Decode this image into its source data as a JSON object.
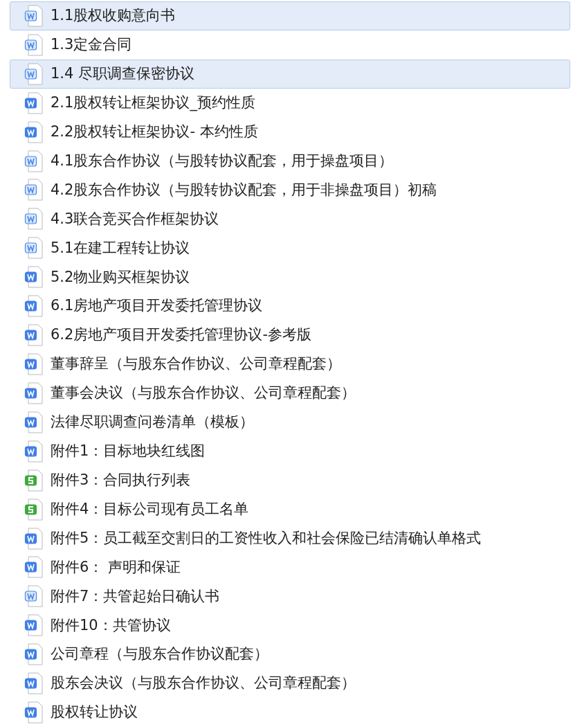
{
  "files": [
    {
      "name": "1.1股权收购意向书",
      "kind": "doc-outline",
      "selected": true
    },
    {
      "name": "1.3定金合同",
      "kind": "doc-outline",
      "selected": false
    },
    {
      "name": "1.4 尽职调查保密协议",
      "kind": "doc-outline",
      "selected": true
    },
    {
      "name": "2.1股权转让框架协议_预约性质",
      "kind": "doc",
      "selected": false
    },
    {
      "name": "2.2股权转让框架协议- 本约性质",
      "kind": "doc",
      "selected": false
    },
    {
      "name": "4.1股东合作协议（与股转协议配套，用于操盘项目）",
      "kind": "doc-outline",
      "selected": false
    },
    {
      "name": "4.2股东合作协议（与股转协议配套，用于非操盘项目）初稿",
      "kind": "doc-outline",
      "selected": false
    },
    {
      "name": "4.3联合竞买合作框架协议",
      "kind": "doc-outline",
      "selected": false
    },
    {
      "name": "5.1在建工程转让协议",
      "kind": "doc-outline",
      "selected": false
    },
    {
      "name": "5.2物业购买框架协议",
      "kind": "doc",
      "selected": false
    },
    {
      "name": "6.1房地产项目开发委托管理协议",
      "kind": "doc",
      "selected": false
    },
    {
      "name": "6.2房地产项目开发委托管理协议-参考版",
      "kind": "doc",
      "selected": false
    },
    {
      "name": "董事辞呈（与股东合作协议、公司章程配套）",
      "kind": "doc",
      "selected": false
    },
    {
      "name": "董事会决议（与股东合作协议、公司章程配套）",
      "kind": "doc",
      "selected": false
    },
    {
      "name": "法律尽职调查问卷清单（模板）",
      "kind": "doc",
      "selected": false
    },
    {
      "name": "附件1：目标地块红线图",
      "kind": "doc",
      "selected": false
    },
    {
      "name": "附件3：合同执行列表",
      "kind": "sheet",
      "selected": false
    },
    {
      "name": "附件4：目标公司现有员工名单",
      "kind": "sheet",
      "selected": false
    },
    {
      "name": "附件5：员工截至交割日的工资性收入和社会保险已结清确认单格式",
      "kind": "doc",
      "selected": false
    },
    {
      "name": "附件6： 声明和保证",
      "kind": "doc",
      "selected": false
    },
    {
      "name": "附件7：共管起始日确认书",
      "kind": "doc-outline",
      "selected": false
    },
    {
      "name": "附件10：共管协议",
      "kind": "doc",
      "selected": false
    },
    {
      "name": "公司章程（与股东合作协议配套）",
      "kind": "doc",
      "selected": false
    },
    {
      "name": "股东会决议（与股东合作协议、公司章程配套）",
      "kind": "doc",
      "selected": false
    },
    {
      "name": "股权转让协议",
      "kind": "doc",
      "selected": false
    }
  ]
}
